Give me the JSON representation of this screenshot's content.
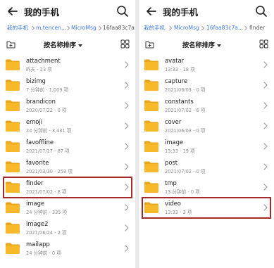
{
  "left": {
    "title": "我的手机",
    "breadcrumb": [
      "我的手机",
      "m.tencen...",
      "MicroMsg",
      "16faa83c7a..."
    ],
    "sort_label": "按名称排序",
    "highlighted_item": "finder",
    "items": [
      {
        "name": "attachment",
        "meta": "昨天 - 23 项"
      },
      {
        "name": "bizimg",
        "meta": "7 分钟前 - 1,009 项"
      },
      {
        "name": "brandicon",
        "meta": "2020/07/22 - 0 项"
      },
      {
        "name": "emoji",
        "meta": "24 分钟前 - 3,431 项"
      },
      {
        "name": "favoffline",
        "meta": "2021/07/17 - 87 项"
      },
      {
        "name": "favorite",
        "meta": "2021/03/30 - 259 项"
      },
      {
        "name": "finder",
        "meta": "2021/07/02 - 8 项"
      },
      {
        "name": "image",
        "meta": "24 分钟前 - 335 项"
      },
      {
        "name": "image2",
        "meta": "2021/06/24 - 2 项"
      },
      {
        "name": "mailapp",
        "meta": "24 分钟前 - 0 项"
      }
    ]
  },
  "right": {
    "title": "我的手机",
    "breadcrumb": [
      "我的手机",
      "MicroMsg",
      "16faa83c7a...",
      "finder"
    ],
    "sort_label": "按名称排序",
    "highlighted_item": "video",
    "items": [
      {
        "name": "avatar",
        "meta": "13:33 - 18 项"
      },
      {
        "name": "capture",
        "meta": "2021/06/03 - 0 项"
      },
      {
        "name": "constants",
        "meta": "2021/07/02 - 6 项"
      },
      {
        "name": "cover",
        "meta": "2021/06/03 - 0 项"
      },
      {
        "name": "image",
        "meta": "13:33 - 19 项"
      },
      {
        "name": "post",
        "meta": "2021/07/02 - 0 项"
      },
      {
        "name": "tmp",
        "meta": "13 分钟前 - 0 项"
      },
      {
        "name": "video",
        "meta": "13:33 - 3 项"
      }
    ]
  },
  "colors": {
    "link": "#3f7be0",
    "folder": "#f7b82a",
    "folder_tab": "#e9a61d",
    "highlight": "#a5282a",
    "meta_text": "#8d8d8d"
  },
  "icons": {
    "back": "arrow-left-icon",
    "search": "search-icon",
    "new_folder": "new-folder-icon",
    "view": "grid-view-icon",
    "folder": "folder-icon",
    "chevron": "chevron-right-icon"
  }
}
